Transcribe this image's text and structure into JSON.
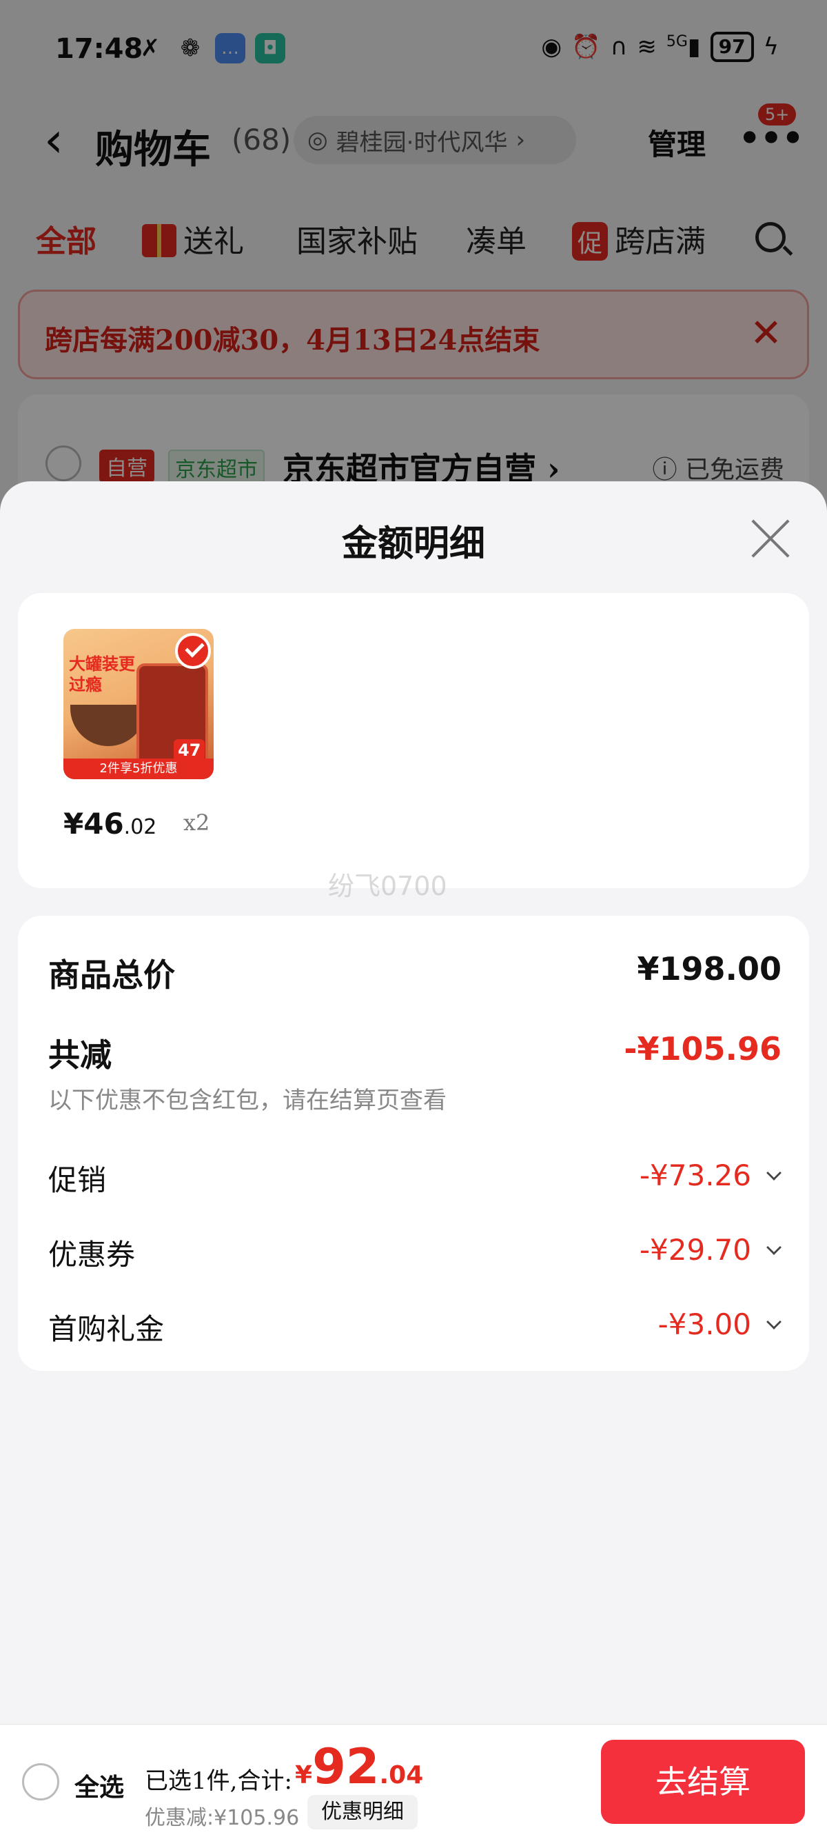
{
  "status_bar": {
    "time": "17:48",
    "battery": "97",
    "network": "5G"
  },
  "header": {
    "title": "购物车",
    "count": "(68)",
    "address": "碧桂园·时代风华",
    "manage": "管理",
    "badge": "5+"
  },
  "tabs": [
    {
      "label": "全部"
    },
    {
      "label": "送礼"
    },
    {
      "label": "国家补贴"
    },
    {
      "label": "凑单"
    },
    {
      "label": "跨店满"
    }
  ],
  "promo_icon": "促",
  "promo_banner": {
    "text": "跨店每满200减30，4月13日24点结束"
  },
  "shop": {
    "tag_self": "自营",
    "tag_jd": "京东超市",
    "name": "京东超市官方自营",
    "shipping": "已免运费"
  },
  "sheet": {
    "title": "金额明细",
    "product": {
      "price_int": "¥46",
      "price_dec": ".02",
      "qty": "x2",
      "image_text": {
        "headline": "大罐装更过瘾",
        "band": "2件享5折优惠",
        "tag": "47"
      }
    },
    "watermark": "纷飞0700",
    "summary": {
      "total_label": "商品总价",
      "total_value": "¥198.00",
      "reduce_label": "共减",
      "reduce_value": "-¥105.96",
      "note": "以下优惠不包含红包，请在结算页查看",
      "items": [
        {
          "label": "促销",
          "value": "-¥73.26"
        },
        {
          "label": "优惠券",
          "value": "-¥29.70"
        },
        {
          "label": "首购礼金",
          "value": "-¥3.00"
        }
      ]
    }
  },
  "bottom_bar": {
    "select_all": "全选",
    "selected": "已选1件,合计:",
    "total_currency": "¥",
    "total_int": "92",
    "total_dec": ".04",
    "discount": "优惠减:¥105.96",
    "detail_button": "优惠明细",
    "checkout": "去结算"
  }
}
